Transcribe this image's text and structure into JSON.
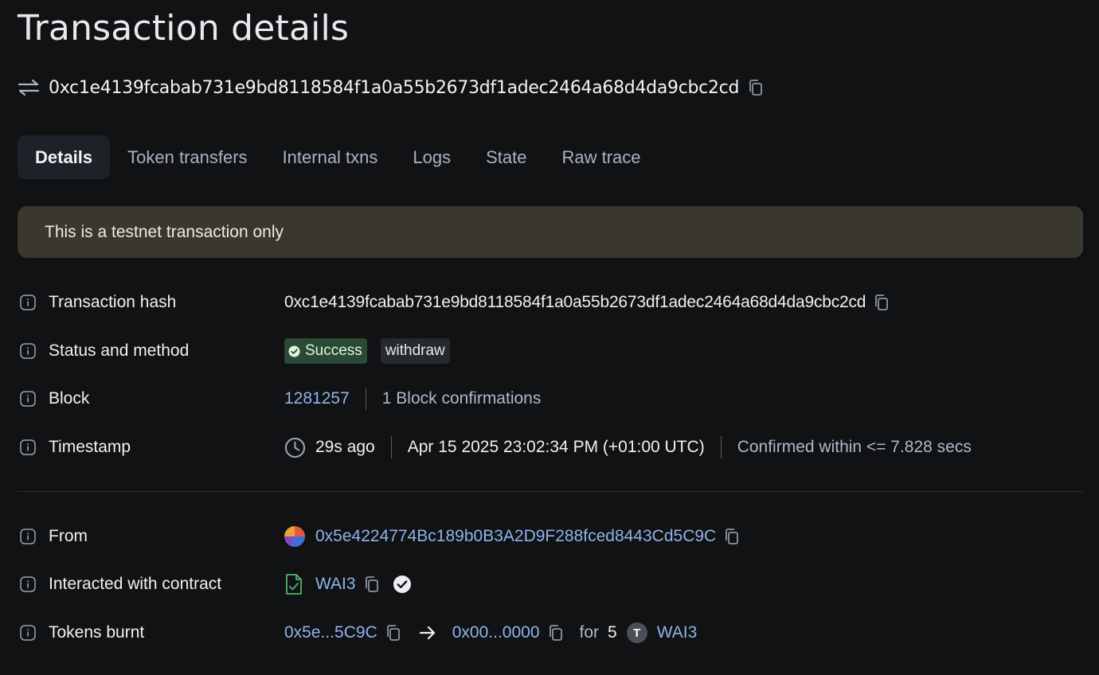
{
  "page_title": "Transaction details",
  "tx_hash": "0xc1e4139fcabab731e9bd8118584f1a0a55b2673df1adec2464a68d4da9cbc2cd",
  "tabs": [
    {
      "label": "Details"
    },
    {
      "label": "Token transfers"
    },
    {
      "label": "Internal txns"
    },
    {
      "label": "Logs"
    },
    {
      "label": "State"
    },
    {
      "label": "Raw trace"
    }
  ],
  "banner": "This is a testnet transaction only",
  "details": {
    "hash_label": "Transaction hash",
    "hash_value": "0xc1e4139fcabab731e9bd8118584f1a0a55b2673df1adec2464a68d4da9cbc2cd",
    "status_label": "Status and method",
    "status": "Success",
    "method": "withdraw",
    "block_label": "Block",
    "block_number": "1281257",
    "block_confirmations": "1 Block confirmations",
    "timestamp_label": "Timestamp",
    "age": "29s ago",
    "datetime": "Apr 15 2025 23:02:34 PM (+01:00 UTC)",
    "confirmed": "Confirmed within <= 7.828 secs",
    "from_label": "From",
    "from_address": "0x5e4224774Bc189b0B3A2D9F288fced8443Cd5C9C",
    "contract_label": "Interacted with contract",
    "contract_name": "WAI3",
    "burnt_label": "Tokens burnt",
    "burnt_from": "0x5e...5C9C",
    "burnt_to": "0x00...0000",
    "burnt_for": "for",
    "burnt_amount": "5",
    "token_letter": "T",
    "token_name": "WAI3"
  },
  "colors": {
    "background": "#111214",
    "link": "#8fb3ea",
    "success_bg": "#2b4a35",
    "banner_bg": "#3a382e"
  },
  "icons": [
    "transfer-arrows-icon",
    "copy-icon",
    "info-icon",
    "check-circle-icon",
    "clock-icon",
    "contract-file-icon",
    "verified-check-icon",
    "arrow-right-icon"
  ]
}
